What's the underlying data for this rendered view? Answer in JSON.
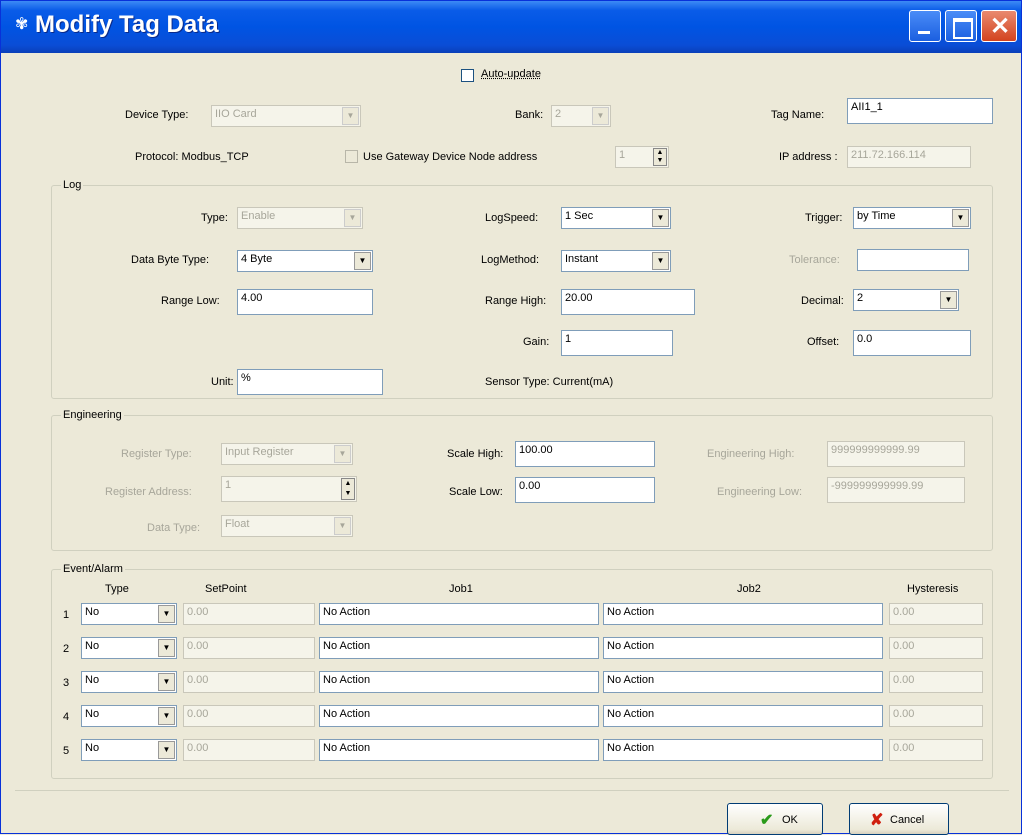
{
  "window": {
    "title": "Modify Tag Data"
  },
  "top": {
    "auto_update_label": "Auto-update",
    "device_type_label": "Device Type:",
    "device_type_value": "IIO Card",
    "bank_label": "Bank:",
    "bank_value": "2",
    "tag_name_label": "Tag Name:",
    "tag_name_value": "AII1_1",
    "protocol_text": "Protocol: Modbus_TCP",
    "use_gateway_label": "Use Gateway Device Node address",
    "node_address_value": "1",
    "ip_address_label": "IP address :",
    "ip_address_value": "211.72.166.114"
  },
  "log": {
    "title": "Log",
    "type_label": "Type:",
    "type_value": "Enable",
    "log_speed_label": "LogSpeed:",
    "log_speed_value": "1 Sec",
    "trigger_label": "Trigger:",
    "trigger_value": "by Time",
    "data_byte_type_label": "Data Byte Type:",
    "data_byte_type_value": "4 Byte",
    "log_method_label": "LogMethod:",
    "log_method_value": "Instant",
    "tolerance_label": "Tolerance:",
    "tolerance_value": "",
    "range_low_label": "Range Low:",
    "range_low_value": "4.00",
    "range_high_label": "Range High:",
    "range_high_value": "20.00",
    "decimal_label": "Decimal:",
    "decimal_value": "2",
    "gain_label": "Gain:",
    "gain_value": "1",
    "offset_label": "Offset:",
    "offset_value": "0.0",
    "unit_label": "Unit:",
    "unit_value": "%",
    "sensor_type_text": "Sensor Type: Current(mA)"
  },
  "engineering": {
    "title": "Engineering",
    "register_type_label": "Register Type:",
    "register_type_value": "Input Register",
    "scale_high_label": "Scale High:",
    "scale_high_value": "100.00",
    "engineering_high_label": "Engineering High:",
    "engineering_high_value": "999999999999.99",
    "register_address_label": "Register Address:",
    "register_address_value": "1",
    "scale_low_label": "Scale Low:",
    "scale_low_value": "0.00",
    "engineering_low_label": "Engineering Low:",
    "engineering_low_value": "-999999999999.99",
    "data_type_label": "Data Type:",
    "data_type_value": "Float"
  },
  "event_alarm": {
    "title": "Event/Alarm",
    "headers": {
      "type": "Type",
      "setpoint": "SetPoint",
      "job1": "Job1",
      "job2": "Job2",
      "hysteresis": "Hysteresis"
    },
    "rows": [
      {
        "num": "1",
        "type": "No",
        "setpoint": "0.00",
        "job1": "No Action",
        "job2": "No Action",
        "hysteresis": "0.00"
      },
      {
        "num": "2",
        "type": "No",
        "setpoint": "0.00",
        "job1": "No Action",
        "job2": "No Action",
        "hysteresis": "0.00"
      },
      {
        "num": "3",
        "type": "No",
        "setpoint": "0.00",
        "job1": "No Action",
        "job2": "No Action",
        "hysteresis": "0.00"
      },
      {
        "num": "4",
        "type": "No",
        "setpoint": "0.00",
        "job1": "No Action",
        "job2": "No Action",
        "hysteresis": "0.00"
      },
      {
        "num": "5",
        "type": "No",
        "setpoint": "0.00",
        "job1": "No Action",
        "job2": "No Action",
        "hysteresis": "0.00"
      }
    ]
  },
  "buttons": {
    "ok_label": "OK",
    "cancel_label": "Cancel"
  },
  "icons": {
    "ok": "checkmark-icon",
    "cancel": "x-icon",
    "title": "app-icon"
  },
  "colors": {
    "titlebar": "#0054e3",
    "ok_check": "#2a9a1a",
    "cancel_x": "#d02010"
  }
}
